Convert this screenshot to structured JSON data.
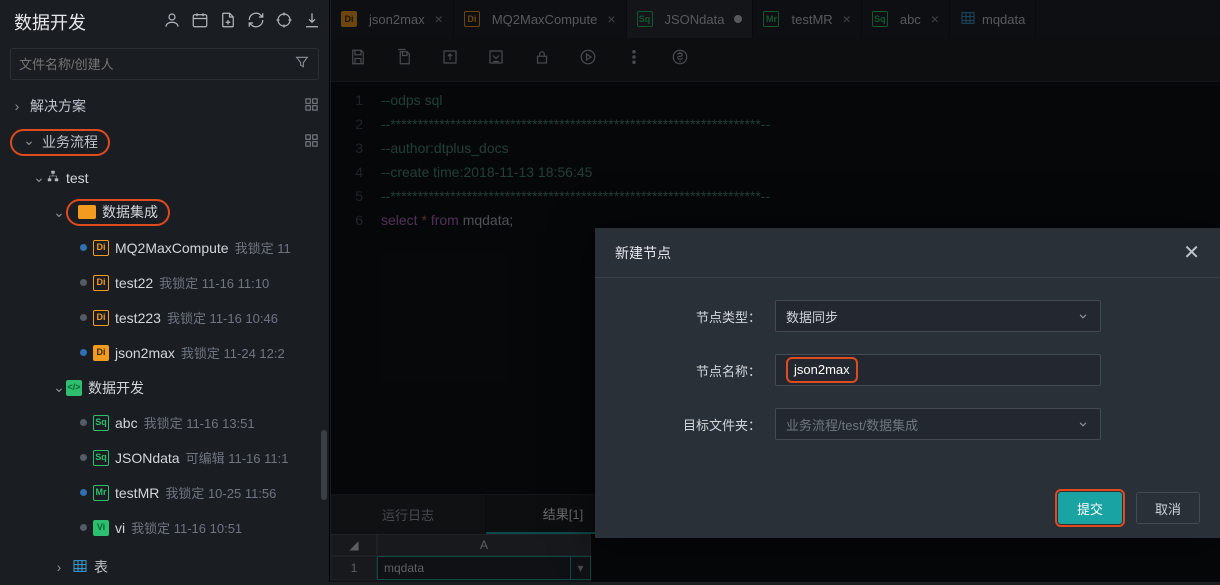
{
  "sidebar": {
    "title": "数据开发",
    "search_placeholder": "文件名称/创建人",
    "sections": {
      "solutions": "解决方案",
      "flows": "业务流程",
      "tables": "表"
    },
    "tree": {
      "root": "test",
      "group_di": "数据集成",
      "group_dev": "数据开发",
      "items": [
        {
          "icon": "Di",
          "name": "MQ2MaxCompute",
          "meta": "我锁定  11"
        },
        {
          "icon": "Di",
          "name": "test22",
          "meta": "我锁定  11-16 11:10"
        },
        {
          "icon": "Di",
          "name": "test223",
          "meta": "我锁定  11-16 10:46"
        },
        {
          "icon": "Di",
          "name": "json2max",
          "meta": "我锁定  11-24 12:2"
        },
        {
          "icon": "Sq",
          "name": "abc",
          "meta": "我锁定  11-16 13:51"
        },
        {
          "icon": "Sq",
          "name": "JSONdata",
          "meta": "可编辑  11-16 11:1"
        },
        {
          "icon": "Mr",
          "name": "testMR",
          "meta": "我锁定  10-25 11:56"
        },
        {
          "icon": "Vi",
          "name": "vi",
          "meta": "我锁定  11-16 10:51"
        }
      ]
    }
  },
  "tabs": [
    {
      "icon": "Di",
      "filled": true,
      "label": "json2max",
      "close": true
    },
    {
      "icon": "Di",
      "filled": false,
      "label": "MQ2MaxCompute",
      "close": true
    },
    {
      "icon": "Sq",
      "label": "JSONdata",
      "dirty": true,
      "active": true
    },
    {
      "icon": "Mr",
      "label": "testMR",
      "close": true
    },
    {
      "icon": "Sq",
      "label": "abc",
      "close": true
    },
    {
      "icon": "table",
      "label": "mqdata"
    }
  ],
  "editor": {
    "lines": [
      {
        "n": "1",
        "cls": "cm-c",
        "text": "--odps sql"
      },
      {
        "n": "2",
        "cls": "cm-star",
        "text": "--********************************************************************--"
      },
      {
        "n": "3",
        "cls": "cm-c",
        "text": "--author:dtplus_docs"
      },
      {
        "n": "4",
        "cls": "cm-c",
        "text": "--create time:2018-11-13 18:56:45"
      },
      {
        "n": "5",
        "cls": "cm-star",
        "text": "--********************************************************************--"
      }
    ],
    "l6": {
      "n": "6",
      "select": "select",
      "star": " * ",
      "from": "from",
      "id": " mqdata",
      "semi": ";"
    }
  },
  "bottom_tabs": {
    "log": "运行日志",
    "result": "结果[1]"
  },
  "grid": {
    "colA": "A",
    "row1": "1",
    "cell": "mqdata"
  },
  "modal": {
    "title": "新建节点",
    "type_label": "节点类型：",
    "type_value": "数据同步",
    "name_label": "节点名称：",
    "name_value": "json2max",
    "folder_label": "目标文件夹：",
    "folder_placeholder": "业务流程/test/数据集成",
    "submit": "提交",
    "cancel": "取消"
  }
}
